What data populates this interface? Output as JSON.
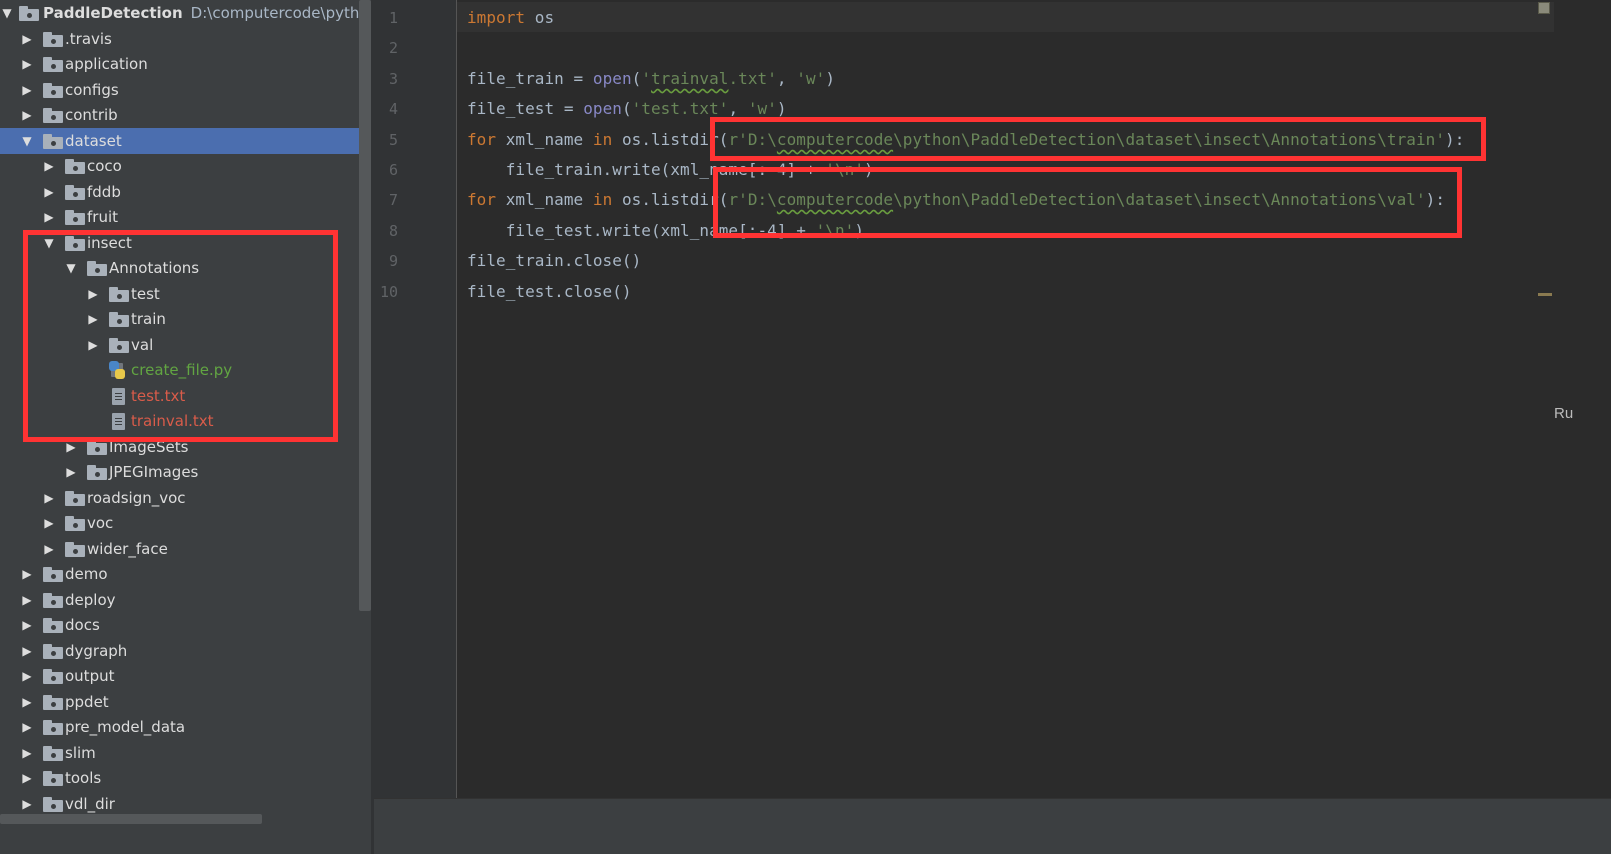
{
  "project_tree": {
    "root": {
      "label": "PaddleDetection",
      "path": "D:\\computercode\\python\\P"
    },
    "items": [
      {
        "label": ".travis",
        "depth": 1,
        "type": "folder",
        "expanded": false
      },
      {
        "label": "application",
        "depth": 1,
        "type": "folder",
        "expanded": false
      },
      {
        "label": "configs",
        "depth": 1,
        "type": "folder",
        "expanded": false
      },
      {
        "label": "contrib",
        "depth": 1,
        "type": "folder",
        "expanded": false
      },
      {
        "label": "dataset",
        "depth": 1,
        "type": "folder",
        "expanded": true,
        "selected": true
      },
      {
        "label": "coco",
        "depth": 2,
        "type": "folder",
        "expanded": false
      },
      {
        "label": "fddb",
        "depth": 2,
        "type": "folder",
        "expanded": false
      },
      {
        "label": "fruit",
        "depth": 2,
        "type": "folder",
        "expanded": false
      },
      {
        "label": "insect",
        "depth": 2,
        "type": "folder",
        "expanded": true
      },
      {
        "label": "Annotations",
        "depth": 3,
        "type": "folder",
        "expanded": true
      },
      {
        "label": "test",
        "depth": 4,
        "type": "folder",
        "expanded": false
      },
      {
        "label": "train",
        "depth": 4,
        "type": "folder",
        "expanded": false
      },
      {
        "label": "val",
        "depth": 4,
        "type": "folder",
        "expanded": false
      },
      {
        "label": "create_file.py",
        "depth": 4,
        "type": "python",
        "status": "added"
      },
      {
        "label": "test.txt",
        "depth": 4,
        "type": "text",
        "status": "untracked"
      },
      {
        "label": "trainval.txt",
        "depth": 4,
        "type": "text",
        "status": "untracked"
      },
      {
        "label": "ImageSets",
        "depth": 3,
        "type": "folder",
        "expanded": false
      },
      {
        "label": "JPEGImages",
        "depth": 3,
        "type": "folder",
        "expanded": false
      },
      {
        "label": "roadsign_voc",
        "depth": 2,
        "type": "folder",
        "expanded": false
      },
      {
        "label": "voc",
        "depth": 2,
        "type": "folder",
        "expanded": false
      },
      {
        "label": "wider_face",
        "depth": 2,
        "type": "folder",
        "expanded": false
      },
      {
        "label": "demo",
        "depth": 1,
        "type": "folder",
        "expanded": false
      },
      {
        "label": "deploy",
        "depth": 1,
        "type": "folder",
        "expanded": false
      },
      {
        "label": "docs",
        "depth": 1,
        "type": "folder",
        "expanded": false
      },
      {
        "label": "dygraph",
        "depth": 1,
        "type": "folder",
        "expanded": false
      },
      {
        "label": "output",
        "depth": 1,
        "type": "folder",
        "expanded": false
      },
      {
        "label": "ppdet",
        "depth": 1,
        "type": "folder",
        "expanded": false
      },
      {
        "label": "pre_model_data",
        "depth": 1,
        "type": "folder",
        "expanded": false
      },
      {
        "label": "slim",
        "depth": 1,
        "type": "folder",
        "expanded": false
      },
      {
        "label": "tools",
        "depth": 1,
        "type": "folder",
        "expanded": false
      },
      {
        "label": "vdl_dir",
        "depth": 1,
        "type": "folder",
        "expanded": false
      }
    ]
  },
  "editor": {
    "line_numbers": [
      "1",
      "2",
      "3",
      "4",
      "5",
      "6",
      "7",
      "8",
      "9",
      "10"
    ],
    "lines": [
      [
        {
          "t": "import",
          "c": "kw"
        },
        {
          "t": " os",
          "c": ""
        }
      ],
      [],
      [
        {
          "t": "file_train = ",
          "c": ""
        },
        {
          "t": "open",
          "c": "bi"
        },
        {
          "t": "(",
          "c": ""
        },
        {
          "t": "'",
          "c": "str"
        },
        {
          "t": "trainval",
          "c": "str wavy"
        },
        {
          "t": ".txt'",
          "c": "str"
        },
        {
          "t": ", ",
          "c": ""
        },
        {
          "t": "'w'",
          "c": "str"
        },
        {
          "t": ")",
          "c": ""
        }
      ],
      [
        {
          "t": "file_test = ",
          "c": ""
        },
        {
          "t": "open",
          "c": "bi"
        },
        {
          "t": "(",
          "c": ""
        },
        {
          "t": "'test.txt'",
          "c": "str"
        },
        {
          "t": ", ",
          "c": ""
        },
        {
          "t": "'w'",
          "c": "str"
        },
        {
          "t": ")",
          "c": ""
        }
      ],
      [
        {
          "t": "for",
          "c": "kw"
        },
        {
          "t": " xml_name ",
          "c": ""
        },
        {
          "t": "in",
          "c": "kw"
        },
        {
          "t": " os.listdir(",
          "c": ""
        },
        {
          "t": "r'D:\\",
          "c": "str"
        },
        {
          "t": "computercode",
          "c": "str wavy"
        },
        {
          "t": "\\python\\PaddleDetection\\dataset\\insect\\Annotations\\train'",
          "c": "str"
        },
        {
          "t": "):",
          "c": ""
        }
      ],
      [
        {
          "t": "    file_train.write(xml_name[:-4] + ",
          "c": ""
        },
        {
          "t": "'\\n'",
          "c": "str"
        },
        {
          "t": ")",
          "c": ""
        }
      ],
      [
        {
          "t": "for",
          "c": "kw"
        },
        {
          "t": " xml_name ",
          "c": ""
        },
        {
          "t": "in",
          "c": "kw"
        },
        {
          "t": " os.listdir(",
          "c": ""
        },
        {
          "t": "r'D:\\",
          "c": "str"
        },
        {
          "t": "computercode",
          "c": "str wavy"
        },
        {
          "t": "\\python\\PaddleDetection\\dataset\\insect\\Annotations\\val'",
          "c": "str"
        },
        {
          "t": "):",
          "c": ""
        }
      ],
      [
        {
          "t": "    file_test.write(xml_name[:-4] + ",
          "c": ""
        },
        {
          "t": "'\\n'",
          "c": "str"
        },
        {
          "t": ")",
          "c": ""
        }
      ],
      [
        {
          "t": "file_train.close()",
          "c": ""
        }
      ],
      [
        {
          "t": "file_test.close()",
          "c": ""
        }
      ]
    ]
  },
  "right_tool_window": {
    "label": "Ru"
  },
  "colors": {
    "selection": "#4b6eaf",
    "annotation_box": "#ff3333",
    "keyword": "#cc7832",
    "string": "#6a8759",
    "builtin": "#8888c6"
  }
}
